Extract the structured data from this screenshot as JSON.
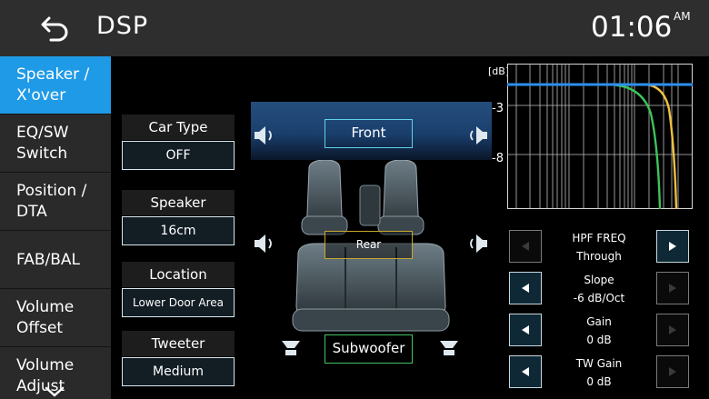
{
  "header": {
    "title": "DSP",
    "clock": "01:06",
    "ampm": "AM"
  },
  "sidebar": {
    "items": [
      {
        "line1": "Speaker /",
        "line2": "X'over"
      },
      {
        "line1": "EQ/SW",
        "line2": "Switch"
      },
      {
        "line1": "Position /",
        "line2": "DTA"
      },
      {
        "line1": "FAB/BAL",
        "line2": ""
      },
      {
        "line1": "Volume",
        "line2": "Offset"
      },
      {
        "line1": "Volume",
        "line2": "Adjust"
      }
    ]
  },
  "settings": {
    "car_type": {
      "label": "Car Type",
      "value": "OFF"
    },
    "speaker": {
      "label": "Speaker",
      "value": "16cm"
    },
    "location": {
      "label": "Location",
      "value": "Lower Door Area"
    },
    "tweeter": {
      "label": "Tweeter",
      "value": "Medium"
    }
  },
  "zones": {
    "front": "Front",
    "rear": "Rear",
    "subwoofer": "Subwoofer"
  },
  "graph": {
    "unit": "[dB]",
    "ticks": [
      "-3",
      "-8"
    ]
  },
  "params": [
    {
      "name": "HPF FREQ",
      "value": "Through"
    },
    {
      "name": "Slope",
      "value": "-6 dB/Oct"
    },
    {
      "name": "Gain",
      "value": "0 dB"
    },
    {
      "name": "TW Gain",
      "value": "0 dB"
    }
  ],
  "colors": {
    "accent": "#1f9ae6",
    "front": "#5fd2ec",
    "rear": "#c8a72c",
    "sub": "#44c460",
    "curve_flat": "#2d8ff0",
    "curve_green": "#3cc45a",
    "curve_yellow": "#f0c040"
  }
}
